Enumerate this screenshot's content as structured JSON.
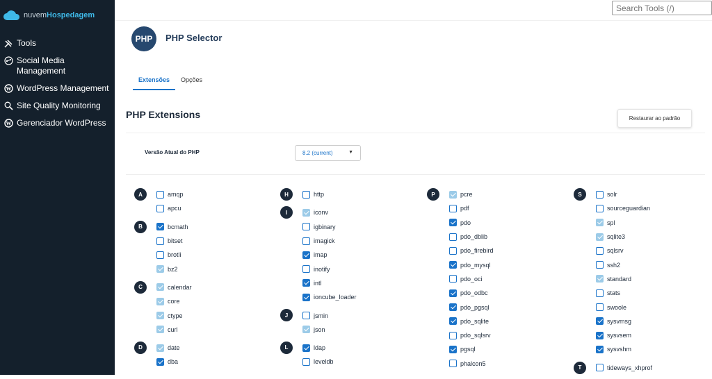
{
  "sidebar": {
    "logo_prefix": "nuvem",
    "logo_brand": "Hospedagem",
    "items": [
      {
        "label": "Tools",
        "icon": "tools-icon"
      },
      {
        "label": "Social Media Management",
        "icon": "share-icon"
      },
      {
        "label": "WordPress Management",
        "icon": "wordpress-icon"
      },
      {
        "label": "Site Quality Monitoring",
        "icon": "search-icon"
      },
      {
        "label": "Gerenciador WordPress",
        "icon": "wordpress-icon"
      }
    ]
  },
  "search": {
    "placeholder": "Search Tools (/)"
  },
  "page": {
    "logo": "PHP",
    "title": "PHP Selector"
  },
  "tabs": [
    {
      "label": "Extensões",
      "active": true
    },
    {
      "label": "Opções",
      "active": false
    }
  ],
  "section_title": "PHP Extensions",
  "restore_label": "Restaurar ao padrão",
  "version": {
    "label": "Versão Atual do PHP",
    "value": "8.2 (current)"
  },
  "colors": {
    "accent": "#1a73c9",
    "sidebar": "#14202c",
    "disabled": "#9ccbe8"
  },
  "columns": [
    [
      {
        "letter": "A",
        "items": [
          {
            "name": "amqp",
            "state": "unchecked"
          },
          {
            "name": "apcu",
            "state": "unchecked"
          }
        ]
      },
      {
        "letter": "B",
        "items": [
          {
            "name": "bcmath",
            "state": "checked"
          },
          {
            "name": "bitset",
            "state": "unchecked"
          },
          {
            "name": "brotli",
            "state": "unchecked"
          },
          {
            "name": "bz2",
            "state": "disabled"
          }
        ]
      },
      {
        "letter": "C",
        "items": [
          {
            "name": "calendar",
            "state": "disabled"
          },
          {
            "name": "core",
            "state": "disabled"
          },
          {
            "name": "ctype",
            "state": "disabled"
          },
          {
            "name": "curl",
            "state": "disabled"
          }
        ]
      },
      {
        "letter": "D",
        "items": [
          {
            "name": "date",
            "state": "disabled"
          },
          {
            "name": "dba",
            "state": "checked"
          }
        ]
      }
    ],
    [
      {
        "letter": "H",
        "items": [
          {
            "name": "http",
            "state": "unchecked"
          }
        ]
      },
      {
        "letter": "I",
        "items": [
          {
            "name": "iconv",
            "state": "disabled"
          },
          {
            "name": "igbinary",
            "state": "unchecked"
          },
          {
            "name": "imagick",
            "state": "unchecked"
          },
          {
            "name": "imap",
            "state": "checked"
          },
          {
            "name": "inotify",
            "state": "unchecked"
          },
          {
            "name": "intl",
            "state": "checked"
          },
          {
            "name": "ioncube_loader",
            "state": "checked"
          }
        ]
      },
      {
        "letter": "J",
        "items": [
          {
            "name": "jsmin",
            "state": "unchecked"
          },
          {
            "name": "json",
            "state": "disabled"
          }
        ]
      },
      {
        "letter": "L",
        "items": [
          {
            "name": "ldap",
            "state": "checked"
          },
          {
            "name": "leveldb",
            "state": "unchecked"
          }
        ]
      }
    ],
    [
      {
        "letter": "P",
        "items": [
          {
            "name": "pcre",
            "state": "disabled"
          },
          {
            "name": "pdf",
            "state": "unchecked"
          },
          {
            "name": "pdo",
            "state": "checked"
          },
          {
            "name": "pdo_dblib",
            "state": "unchecked"
          },
          {
            "name": "pdo_firebird",
            "state": "unchecked"
          },
          {
            "name": "pdo_mysql",
            "state": "checked"
          },
          {
            "name": "pdo_oci",
            "state": "unchecked"
          },
          {
            "name": "pdo_odbc",
            "state": "checked"
          },
          {
            "name": "pdo_pgsql",
            "state": "checked"
          },
          {
            "name": "pdo_sqlite",
            "state": "checked"
          },
          {
            "name": "pdo_sqlsrv",
            "state": "unchecked"
          },
          {
            "name": "pgsql",
            "state": "checked"
          },
          {
            "name": "phalcon5",
            "state": "unchecked"
          }
        ]
      }
    ],
    [
      {
        "letter": "S",
        "items": [
          {
            "name": "solr",
            "state": "unchecked"
          },
          {
            "name": "sourceguardian",
            "state": "unchecked"
          },
          {
            "name": "spl",
            "state": "disabled"
          },
          {
            "name": "sqlite3",
            "state": "disabled"
          },
          {
            "name": "sqlsrv",
            "state": "unchecked"
          },
          {
            "name": "ssh2",
            "state": "unchecked"
          },
          {
            "name": "standard",
            "state": "disabled"
          },
          {
            "name": "stats",
            "state": "unchecked"
          },
          {
            "name": "swoole",
            "state": "unchecked"
          },
          {
            "name": "sysvmsg",
            "state": "checked"
          },
          {
            "name": "sysvsem",
            "state": "checked"
          },
          {
            "name": "sysvshm",
            "state": "checked"
          }
        ]
      },
      {
        "letter": "T",
        "items": [
          {
            "name": "tideways_xhprof",
            "state": "unchecked"
          }
        ]
      }
    ]
  ]
}
